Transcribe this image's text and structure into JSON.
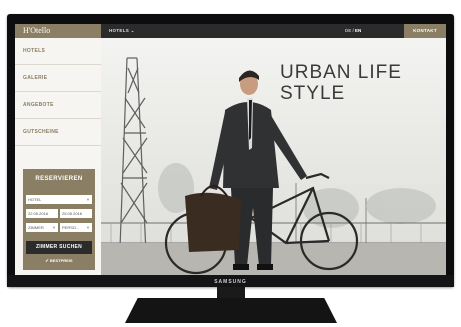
{
  "tv": {
    "brand": "SAMSUNG"
  },
  "header": {
    "logo": "H'Otello",
    "nav_hotels": "HOTELS ⌄",
    "lang_de": "DE",
    "lang_sep": " / ",
    "lang_en": "EN",
    "contact": "KONTAKT"
  },
  "sidebar": {
    "items": [
      {
        "label": "HOTELS"
      },
      {
        "label": "GALERIE"
      },
      {
        "label": "ANGEBOTE"
      },
      {
        "label": "GUTSCHEINE"
      }
    ]
  },
  "booking": {
    "title": "RESERVIEREN",
    "hotel_select": "HOTEL",
    "date_from": "22.05.2016",
    "date_to": "25.05.2016",
    "rooms_select": "ZIMMER",
    "persons_select": "PERSO...",
    "search_button": "ZIMMER SUCHEN",
    "best_price": "BESTPREIS"
  },
  "hero": {
    "headline_line1": "URBAN LIFE",
    "headline_line2": "STYLE"
  }
}
